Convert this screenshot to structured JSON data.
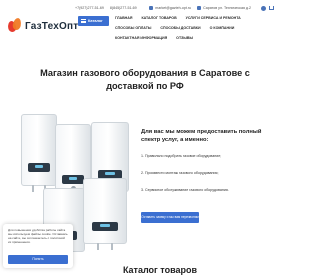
{
  "logo": {
    "name": "ГазТехОпт"
  },
  "topbar": {
    "phone1": "+7(927)277-51-69",
    "phone2": "8(845)277-51-69",
    "email": "market@gazteh-opt.ru",
    "address": "Саратов ул. Техническая д.2"
  },
  "catalog_button": {
    "label": "Каталог"
  },
  "nav": {
    "items": [
      "Главная",
      "Каталог товаров",
      "Услуги сервиса и ремонта",
      "Способы оплаты",
      "Способы доставки",
      "О компании",
      "Контактная информация",
      "Отзывы"
    ]
  },
  "hero": {
    "title": "Магазин газового оборудования в Саратове с доставкой по РФ"
  },
  "services": {
    "heading": "Для вас мы можем предоставить полный спектр услуг, а именно:",
    "items": [
      "1. Правильно подобрать газовое оборудование;",
      "2. Произвести монтаж газового оборудования;",
      "3. Сервисное обслуживание газового оборудования."
    ],
    "button": "Оставить заявку и мы вам перезвоним"
  },
  "cookie": {
    "text": "Для повышения удобства работы сайта мы используем файлы cookie. Оставаясь на сайте, вы соглашаетесь с политикой их применения.",
    "button": "Понять"
  },
  "catalog_section": {
    "title": "Каталог товаров"
  },
  "colors": {
    "accent": "#3b6fd1",
    "logo_red": "#e63b2e",
    "logo_orange": "#f07a24"
  }
}
